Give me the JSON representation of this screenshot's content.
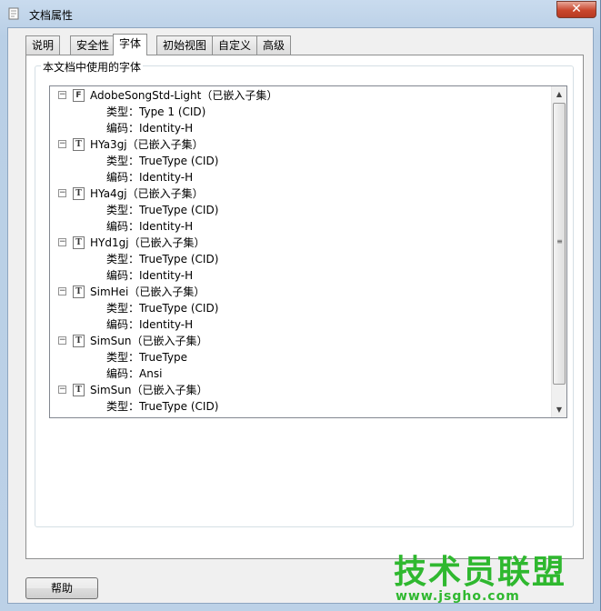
{
  "window": {
    "title": "文档属性",
    "close_glyph": "✕"
  },
  "tabs": [
    {
      "label": "说明",
      "active": false
    },
    {
      "label": "安全性",
      "active": false
    },
    {
      "label": "字体",
      "active": true
    },
    {
      "label": "初始视图",
      "active": false
    },
    {
      "label": "自定义",
      "active": false
    },
    {
      "label": "高级",
      "active": false
    }
  ],
  "group": {
    "label": "本文档中使用的字体"
  },
  "fonts": [
    {
      "name": "AdobeSongStd-Light（已嵌入子集）",
      "icon": "type1-font-icon",
      "type_line": "类型：Type 1 (CID)",
      "encoding_line": "编码：Identity-H"
    },
    {
      "name": "HYa3gj（已嵌入子集）",
      "icon": "truetype-font-icon",
      "type_line": "类型：TrueType (CID)",
      "encoding_line": "编码：Identity-H"
    },
    {
      "name": "HYa4gj（已嵌入子集）",
      "icon": "truetype-font-icon",
      "type_line": "类型：TrueType (CID)",
      "encoding_line": "编码：Identity-H"
    },
    {
      "name": "HYd1gj（已嵌入子集）",
      "icon": "truetype-font-icon",
      "type_line": "类型：TrueType (CID)",
      "encoding_line": "编码：Identity-H"
    },
    {
      "name": "SimHei（已嵌入子集）",
      "icon": "truetype-font-icon",
      "type_line": "类型：TrueType (CID)",
      "encoding_line": "编码：Identity-H"
    },
    {
      "name": "SimSun（已嵌入子集）",
      "icon": "truetype-font-icon",
      "type_line": "类型：TrueType",
      "encoding_line": "编码：Ansi"
    },
    {
      "name": "SimSun（已嵌入子集）",
      "icon": "truetype-font-icon",
      "type_line": "类型：TrueType (CID)",
      "encoding_line": ""
    }
  ],
  "buttons": {
    "help": "帮助"
  },
  "watermark": {
    "brand": "技术员联盟",
    "url": "www.jsgho.com",
    "color": "#2fb82f"
  }
}
